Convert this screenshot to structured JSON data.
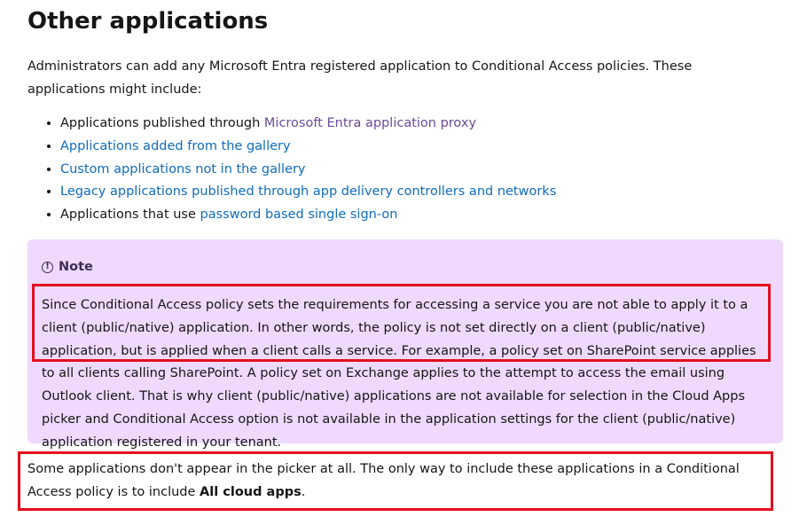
{
  "heading": "Other applications",
  "intro": "Administrators can add any Microsoft Entra registered application to Conditional Access policies. These applications might include:",
  "list": {
    "item1_prefix": "Applications published through ",
    "item1_link": "Microsoft Entra application proxy",
    "item2_link": "Applications added from the gallery",
    "item3_link": "Custom applications not in the gallery",
    "item4_link": "Legacy applications published through app delivery controllers and networks",
    "item5_prefix": "Applications that use ",
    "item5_link": "password based single sign-on"
  },
  "note": {
    "icon": "info-icon",
    "title": "Note",
    "body": "Since Conditional Access policy sets the requirements for accessing a service you are not able to apply it to a client (public/native) application. In other words, the policy is not set directly on a client (public/native) application, but is applied when a client calls a service. For example, a policy set on SharePoint service applies to all clients calling SharePoint. A policy set on Exchange applies to the attempt to access the email using Outlook client. That is why client (public/native) applications are not available for selection in the Cloud Apps picker and Conditional Access option is not available in the application settings for the client (public/native) application registered in your tenant."
  },
  "closing": {
    "text": "Some applications don't appear in the picker at all. The only way to include these applications in a Conditional Access policy is to include",
    "bold": "All cloud apps",
    "end": "."
  },
  "colors": {
    "link": "#0f6cbd",
    "visited_link": "#6b4a9a",
    "note_bg": "#efd9fd",
    "highlight": "#e2101d"
  }
}
